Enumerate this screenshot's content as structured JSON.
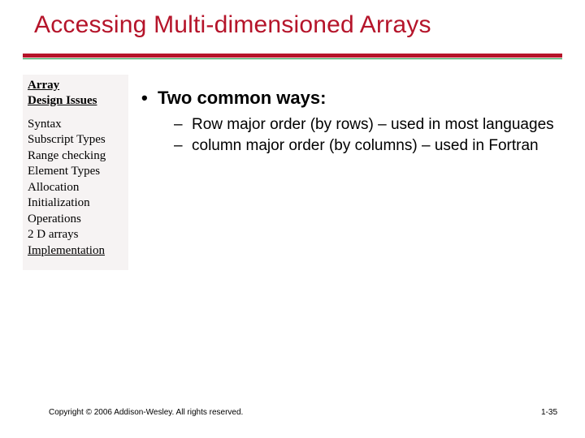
{
  "title": "Accessing Multi-dimensioned Arrays",
  "sidebar": {
    "heading_line1": "Array",
    "heading_line2": "Design Issues",
    "items": [
      {
        "label": "Syntax",
        "linked": false
      },
      {
        "label": "Subscript Types",
        "linked": false
      },
      {
        "label": "Range checking",
        "linked": false
      },
      {
        "label": "Element Types",
        "linked": false
      },
      {
        "label": "Allocation",
        "linked": false
      },
      {
        "label": "Initialization",
        "linked": false
      },
      {
        "label": "Operations",
        "linked": false
      },
      {
        "label": "2 D arrays",
        "linked": false
      },
      {
        "label": "Implementation",
        "linked": true
      }
    ]
  },
  "content": {
    "bullet": "Two common ways:",
    "subs": [
      "Row major order (by rows) – used in most languages",
      "column major order (by columns) – used in Fortran"
    ]
  },
  "footer": {
    "left": "Copyright © 2006 Addison-Wesley. All rights reserved.",
    "right": "1-35"
  }
}
